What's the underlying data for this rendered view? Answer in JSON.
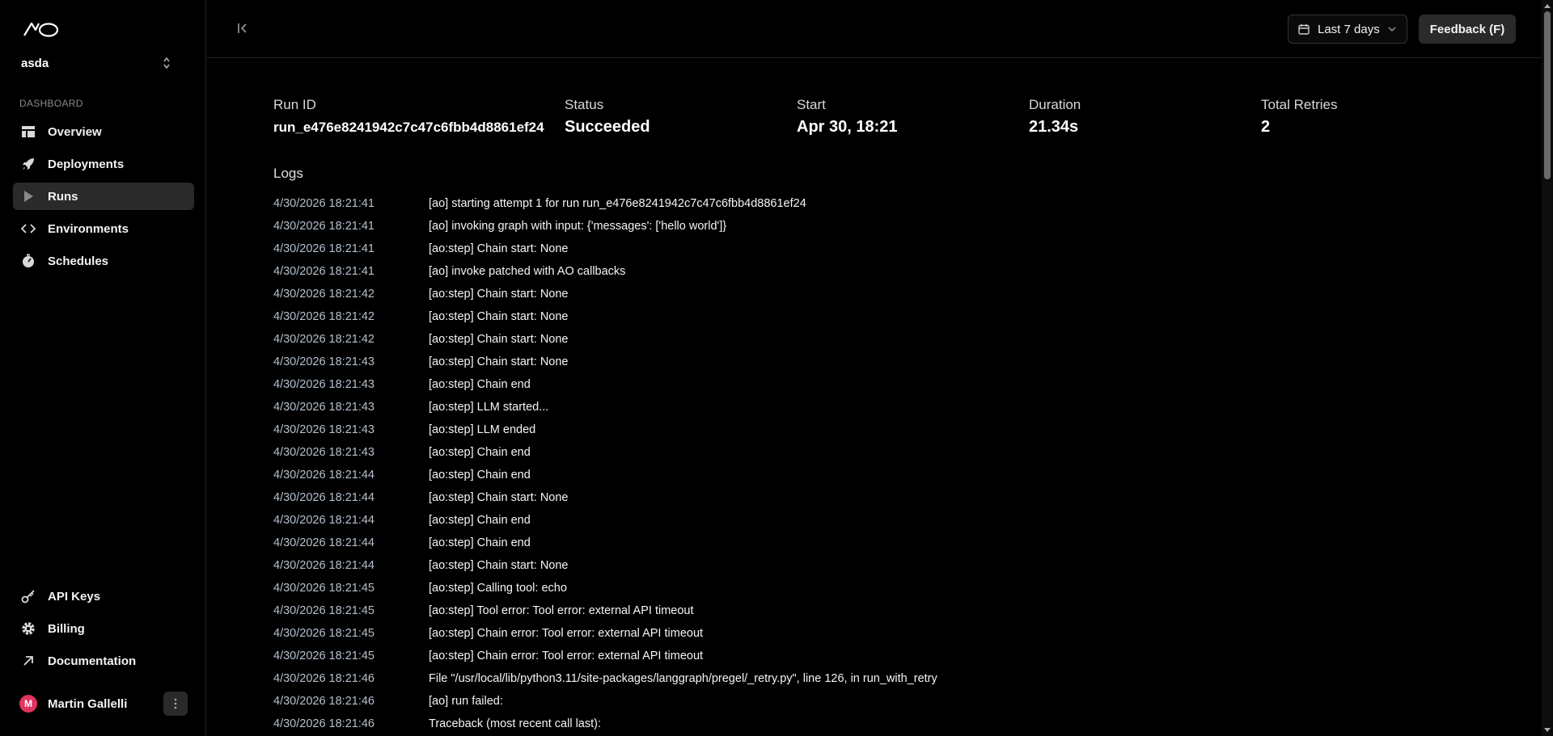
{
  "sidebar": {
    "workspace": "asda",
    "section_label": "DASHBOARD",
    "nav_items": [
      {
        "label": "Overview",
        "icon": "layout-icon"
      },
      {
        "label": "Deployments",
        "icon": "rocket-icon"
      },
      {
        "label": "Runs",
        "icon": "play-icon",
        "active": true
      },
      {
        "label": "Environments",
        "icon": "code-icon"
      },
      {
        "label": "Schedules",
        "icon": "stopwatch-icon"
      }
    ],
    "bottom_items": [
      {
        "label": "API Keys",
        "icon": "key-icon"
      },
      {
        "label": "Billing",
        "icon": "gear-icon"
      },
      {
        "label": "Documentation",
        "icon": "external-link-icon"
      }
    ],
    "user": {
      "initial": "M",
      "name": "Martin Gallelli"
    }
  },
  "header": {
    "date_range": "Last 7 days",
    "feedback": "Feedback (F)"
  },
  "run": {
    "run_id_label": "Run ID",
    "run_id": "run_e476e8241942c7c47c6fbb4d8861ef24",
    "status_label": "Status",
    "status": "Succeeded",
    "start_label": "Start",
    "start": "Apr 30, 18:21",
    "duration_label": "Duration",
    "duration": "21.34s",
    "retries_label": "Total Retries",
    "retries": "2"
  },
  "logs_title": "Logs",
  "logs": [
    {
      "ts": "4/30/2026 18:21:41",
      "msg": "[ao] starting attempt 1 for run run_e476e8241942c7c47c6fbb4d8861ef24"
    },
    {
      "ts": "4/30/2026 18:21:41",
      "msg": "[ao] invoking graph with input: {'messages': ['hello world']}"
    },
    {
      "ts": "4/30/2026 18:21:41",
      "msg": "[ao:step] Chain start: None"
    },
    {
      "ts": "4/30/2026 18:21:41",
      "msg": "[ao] invoke patched with AO callbacks"
    },
    {
      "ts": "4/30/2026 18:21:42",
      "msg": "[ao:step] Chain start: None"
    },
    {
      "ts": "4/30/2026 18:21:42",
      "msg": "[ao:step] Chain start: None"
    },
    {
      "ts": "4/30/2026 18:21:42",
      "msg": "[ao:step] Chain start: None"
    },
    {
      "ts": "4/30/2026 18:21:43",
      "msg": "[ao:step] Chain start: None"
    },
    {
      "ts": "4/30/2026 18:21:43",
      "msg": "[ao:step] Chain end"
    },
    {
      "ts": "4/30/2026 18:21:43",
      "msg": "[ao:step] LLM started..."
    },
    {
      "ts": "4/30/2026 18:21:43",
      "msg": "[ao:step] LLM ended"
    },
    {
      "ts": "4/30/2026 18:21:43",
      "msg": "[ao:step] Chain end"
    },
    {
      "ts": "4/30/2026 18:21:44",
      "msg": "[ao:step] Chain end"
    },
    {
      "ts": "4/30/2026 18:21:44",
      "msg": "[ao:step] Chain start: None"
    },
    {
      "ts": "4/30/2026 18:21:44",
      "msg": "[ao:step] Chain end"
    },
    {
      "ts": "4/30/2026 18:21:44",
      "msg": "[ao:step] Chain end"
    },
    {
      "ts": "4/30/2026 18:21:44",
      "msg": "[ao:step] Chain start: None"
    },
    {
      "ts": "4/30/2026 18:21:45",
      "msg": "[ao:step] Calling tool: echo"
    },
    {
      "ts": "4/30/2026 18:21:45",
      "msg": "[ao:step] Tool error: Tool error: external API timeout"
    },
    {
      "ts": "4/30/2026 18:21:45",
      "msg": "[ao:step] Chain error: Tool error: external API timeout"
    },
    {
      "ts": "4/30/2026 18:21:45",
      "msg": "[ao:step] Chain error: Tool error: external API timeout"
    },
    {
      "ts": "4/30/2026 18:21:46",
      "msg": "File \"/usr/local/lib/python3.11/site-packages/langgraph/pregel/_retry.py\", line 126, in run_with_retry"
    },
    {
      "ts": "4/30/2026 18:21:46",
      "msg": "[ao] run failed:"
    },
    {
      "ts": "4/30/2026 18:21:46",
      "msg": "Traceback (most recent call last):"
    }
  ]
}
